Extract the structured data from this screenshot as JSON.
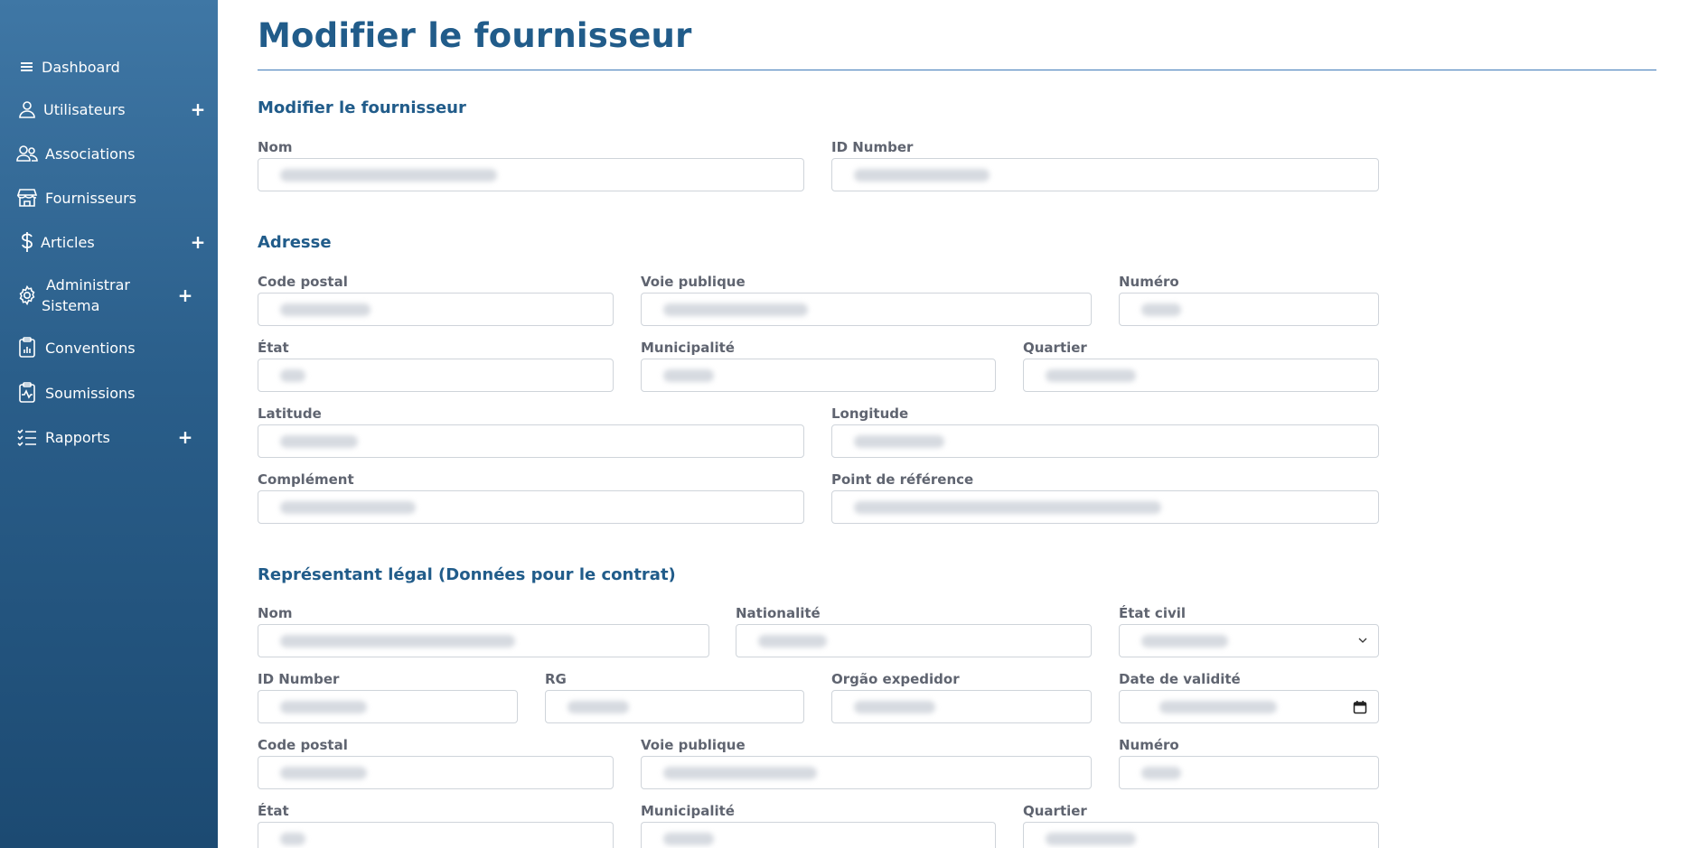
{
  "sidebar": {
    "items": [
      {
        "label": "Dashboard",
        "icon": "menu-icon",
        "expandable": false
      },
      {
        "label": "Utilisateurs",
        "icon": "user-icon",
        "expandable": true
      },
      {
        "label": "Associations",
        "icon": "users-icon",
        "expandable": false
      },
      {
        "label": "Fournisseurs",
        "icon": "store-icon",
        "expandable": false
      },
      {
        "label": "Articles",
        "icon": "dollar-icon",
        "expandable": true
      },
      {
        "label": "Administrar Sistema",
        "icon": "gear-icon",
        "expandable": true
      },
      {
        "label": "Conventions",
        "icon": "clipboard-chart-icon",
        "expandable": false
      },
      {
        "label": "Soumissions",
        "icon": "clipboard-pulse-icon",
        "expandable": false
      },
      {
        "label": "Rapports",
        "icon": "checklist-icon",
        "expandable": true
      }
    ],
    "expand_symbol": "+"
  },
  "page": {
    "title": "Modifier le fournisseur"
  },
  "supplier": {
    "section_title": "Modifier le fournisseur",
    "name_label": "Nom",
    "id_label": "ID Number"
  },
  "address": {
    "section_title": "Adresse",
    "postal_code_label": "Code postal",
    "street_label": "Voie publique",
    "number_label": "Numéro",
    "state_label": "État",
    "city_label": "Municipalité",
    "district_label": "Quartier",
    "latitude_label": "Latitude",
    "longitude_label": "Longitude",
    "complement_label": "Complément",
    "reference_label": "Point de référence"
  },
  "legal_rep": {
    "section_title": "Représentant légal (Données pour le contrat)",
    "name_label": "Nom",
    "nationality_label": "Nationalité",
    "marital_status_label": "État civil",
    "id_label": "ID Number",
    "rg_label": "RG",
    "issuer_label": "Orgão expedidor",
    "validity_label": "Date de validité",
    "postal_code_label": "Code postal",
    "street_label": "Voie publique",
    "number_label": "Numéro",
    "state_label": "État",
    "city_label": "Municipalité",
    "district_label": "Quartier"
  },
  "colors": {
    "sidebar_top": "#3f77a5",
    "sidebar_bottom": "#1c4a72",
    "heading": "#215c8a",
    "label": "#5f6470",
    "rule": "#3f7ab8"
  }
}
